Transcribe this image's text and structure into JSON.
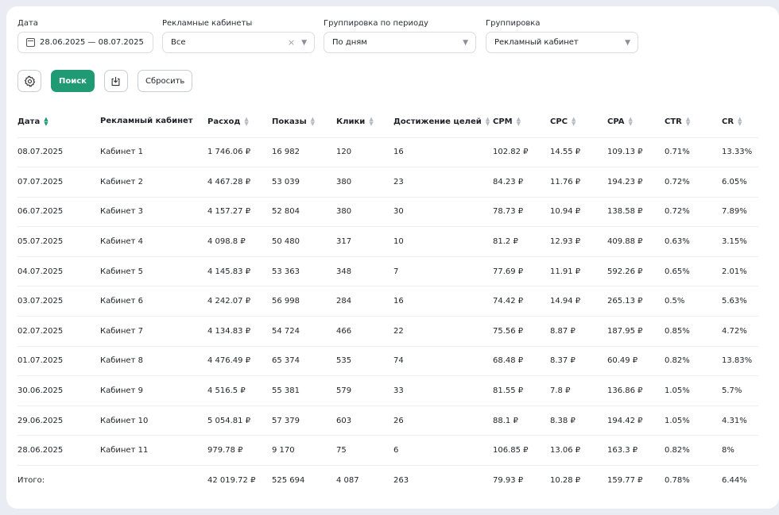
{
  "filters": {
    "date": {
      "label": "Дата",
      "value": "28.06.2025 — 08.07.2025"
    },
    "cabinets": {
      "label": "Рекламные кабинеты",
      "value": "Все"
    },
    "period": {
      "label": "Группировка по периоду",
      "value": "По дням"
    },
    "grouping": {
      "label": "Группировка",
      "value": "Рекламный кабинет"
    }
  },
  "actions": {
    "search_label": "Поиск",
    "reset_label": "Сбросить"
  },
  "colors": {
    "accent": "#1f9a73"
  },
  "icons": {
    "settings": "gear-icon",
    "export": "download-icon",
    "calendar": "calendar-icon"
  },
  "table": {
    "columns": [
      "Дата",
      "Рекламный кабинет",
      "Расход",
      "Показы",
      "Клики",
      "Достижение целей",
      "CPM",
      "CPC",
      "CPA",
      "CTR",
      "CR"
    ],
    "rows": [
      [
        "08.07.2025",
        "Кабинет 1",
        "1 746.06 ₽",
        "16 982",
        "120",
        "16",
        "102.82 ₽",
        "14.55 ₽",
        "109.13 ₽",
        "0.71%",
        "13.33%"
      ],
      [
        "07.07.2025",
        "Кабинет 2",
        "4 467.28 ₽",
        "53 039",
        "380",
        "23",
        "84.23 ₽",
        "11.76 ₽",
        "194.23 ₽",
        "0.72%",
        "6.05%"
      ],
      [
        "06.07.2025",
        "Кабинет 3",
        "4 157.27 ₽",
        "52 804",
        "380",
        "30",
        "78.73 ₽",
        "10.94 ₽",
        "138.58 ₽",
        "0.72%",
        "7.89%"
      ],
      [
        "05.07.2025",
        "Кабинет 4",
        "4 098.8 ₽",
        "50 480",
        "317",
        "10",
        "81.2 ₽",
        "12.93 ₽",
        "409.88 ₽",
        "0.63%",
        "3.15%"
      ],
      [
        "04.07.2025",
        "Кабинет 5",
        "4 145.83 ₽",
        "53 363",
        "348",
        "7",
        "77.69 ₽",
        "11.91 ₽",
        "592.26 ₽",
        "0.65%",
        "2.01%"
      ],
      [
        "03.07.2025",
        "Кабинет 6",
        "4 242.07 ₽",
        "56 998",
        "284",
        "16",
        "74.42 ₽",
        "14.94 ₽",
        "265.13 ₽",
        "0.5%",
        "5.63%"
      ],
      [
        "02.07.2025",
        "Кабинет 7",
        "4 134.83 ₽",
        "54 724",
        "466",
        "22",
        "75.56 ₽",
        "8.87 ₽",
        "187.95 ₽",
        "0.85%",
        "4.72%"
      ],
      [
        "01.07.2025",
        "Кабинет 8",
        "4 476.49 ₽",
        "65 374",
        "535",
        "74",
        "68.48 ₽",
        "8.37 ₽",
        "60.49 ₽",
        "0.82%",
        "13.83%"
      ],
      [
        "30.06.2025",
        "Кабинет 9",
        "4 516.5 ₽",
        "55 381",
        "579",
        "33",
        "81.55 ₽",
        "7.8 ₽",
        "136.86 ₽",
        "1.05%",
        "5.7%"
      ],
      [
        "29.06.2025",
        "Кабинет 10",
        "5 054.81 ₽",
        "57 379",
        "603",
        "26",
        "88.1 ₽",
        "8.38 ₽",
        "194.42 ₽",
        "1.05%",
        "4.31%"
      ],
      [
        "28.06.2025",
        "Кабинет 11",
        "979.78 ₽",
        "9 170",
        "75",
        "6",
        "106.85 ₽",
        "13.06 ₽",
        "163.3 ₽",
        "0.82%",
        "8%"
      ]
    ],
    "totals": [
      "Итого:",
      "",
      "42 019.72 ₽",
      "525 694",
      "4 087",
      "263",
      "79.93 ₽",
      "10.28 ₽",
      "159.77 ₽",
      "0.78%",
      "6.44%"
    ]
  }
}
